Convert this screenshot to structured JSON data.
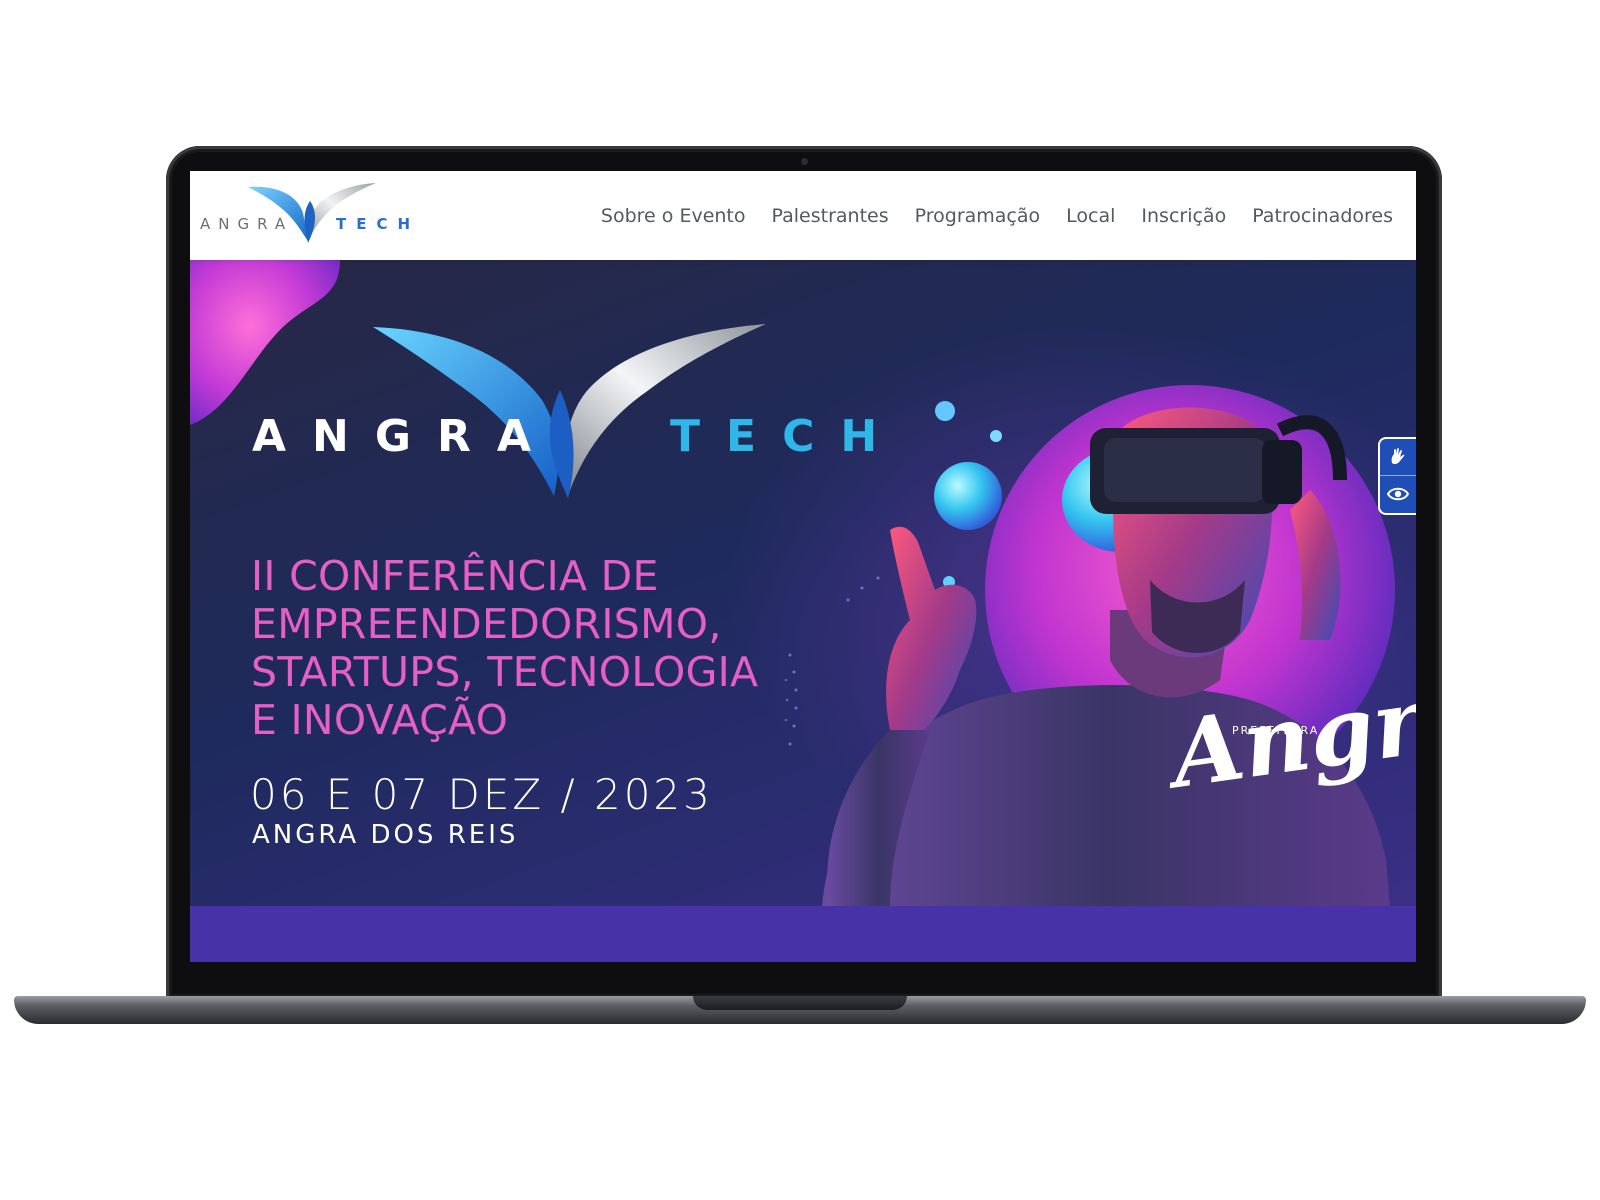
{
  "nav": {
    "logo": {
      "left_word": "ANGRA",
      "right_word": "TECH"
    },
    "links": [
      {
        "label": "Sobre o Evento"
      },
      {
        "label": "Palestrantes"
      },
      {
        "label": "Programação"
      },
      {
        "label": "Local"
      },
      {
        "label": "Inscrição"
      },
      {
        "label": "Patrocinadores"
      }
    ]
  },
  "hero": {
    "logo": {
      "left_word": "ANGRA",
      "right_word": "TECH"
    },
    "headline_lines": [
      "II CONFERÊNCIA DE",
      "EMPREENDEDORISMO,",
      "STARTUPS, TECNOLOGIA",
      "E INOVAÇÃO"
    ],
    "date": "06 E 07 DEZ / 2023",
    "city": "ANGRA DOS REIS",
    "sponsor": {
      "small": "PREFEITURA",
      "big": "Angra"
    },
    "image_subject": "man-with-vr-headset"
  },
  "accessibility": {
    "icons": [
      "sign-language-icon",
      "eye-icon"
    ]
  },
  "colors": {
    "accent_pink": "#e55fc6",
    "accent_cyan": "#2fb7ea",
    "hero_bg": "#1e2a5c",
    "footer_band": "#4733a7",
    "a11y_bg": "#1f4fb6"
  }
}
